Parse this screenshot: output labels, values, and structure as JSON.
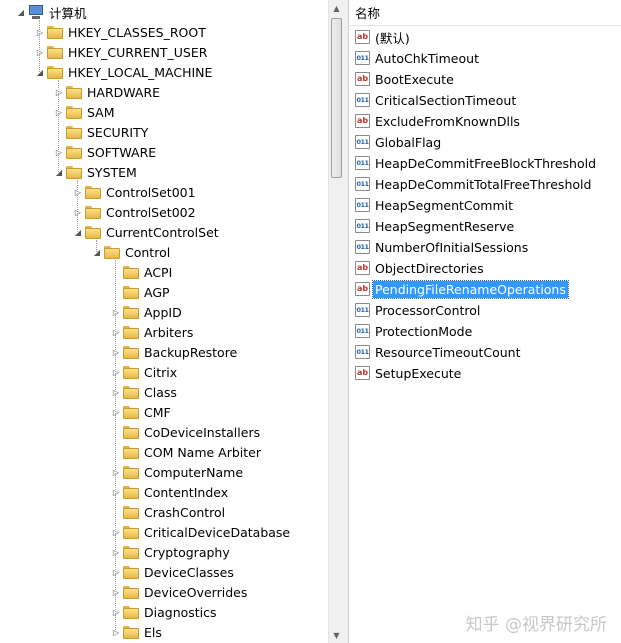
{
  "tree": {
    "items": [
      {
        "label": "计算机",
        "depth": 0,
        "expander": "expanded",
        "icon": "computer-icon"
      },
      {
        "label": "HKEY_CLASSES_ROOT",
        "depth": 1,
        "expander": "collapsed",
        "icon": "folder-icon"
      },
      {
        "label": "HKEY_CURRENT_USER",
        "depth": 1,
        "expander": "collapsed",
        "icon": "folder-icon"
      },
      {
        "label": "HKEY_LOCAL_MACHINE",
        "depth": 1,
        "expander": "expanded",
        "icon": "folder-icon"
      },
      {
        "label": "HARDWARE",
        "depth": 2,
        "expander": "collapsed",
        "icon": "folder-icon"
      },
      {
        "label": "SAM",
        "depth": 2,
        "expander": "collapsed",
        "icon": "folder-icon"
      },
      {
        "label": "SECURITY",
        "depth": 2,
        "expander": "none",
        "icon": "folder-icon"
      },
      {
        "label": "SOFTWARE",
        "depth": 2,
        "expander": "collapsed",
        "icon": "folder-icon"
      },
      {
        "label": "SYSTEM",
        "depth": 2,
        "expander": "expanded",
        "icon": "folder-icon"
      },
      {
        "label": "ControlSet001",
        "depth": 3,
        "expander": "collapsed",
        "icon": "folder-icon"
      },
      {
        "label": "ControlSet002",
        "depth": 3,
        "expander": "collapsed",
        "icon": "folder-icon"
      },
      {
        "label": "CurrentControlSet",
        "depth": 3,
        "expander": "expanded",
        "icon": "folder-icon"
      },
      {
        "label": "Control",
        "depth": 4,
        "expander": "expanded",
        "icon": "folder-icon"
      },
      {
        "label": "ACPI",
        "depth": 5,
        "expander": "none",
        "icon": "folder-icon"
      },
      {
        "label": "AGP",
        "depth": 5,
        "expander": "none",
        "icon": "folder-icon"
      },
      {
        "label": "AppID",
        "depth": 5,
        "expander": "collapsed",
        "icon": "folder-icon"
      },
      {
        "label": "Arbiters",
        "depth": 5,
        "expander": "collapsed",
        "icon": "folder-icon"
      },
      {
        "label": "BackupRestore",
        "depth": 5,
        "expander": "collapsed",
        "icon": "folder-icon"
      },
      {
        "label": "Citrix",
        "depth": 5,
        "expander": "collapsed",
        "icon": "folder-icon"
      },
      {
        "label": "Class",
        "depth": 5,
        "expander": "collapsed",
        "icon": "folder-icon"
      },
      {
        "label": "CMF",
        "depth": 5,
        "expander": "collapsed",
        "icon": "folder-icon"
      },
      {
        "label": "CoDeviceInstallers",
        "depth": 5,
        "expander": "none",
        "icon": "folder-icon"
      },
      {
        "label": "COM Name Arbiter",
        "depth": 5,
        "expander": "none",
        "icon": "folder-icon"
      },
      {
        "label": "ComputerName",
        "depth": 5,
        "expander": "collapsed",
        "icon": "folder-icon"
      },
      {
        "label": "ContentIndex",
        "depth": 5,
        "expander": "collapsed",
        "icon": "folder-icon"
      },
      {
        "label": "CrashControl",
        "depth": 5,
        "expander": "none",
        "icon": "folder-icon"
      },
      {
        "label": "CriticalDeviceDatabase",
        "depth": 5,
        "expander": "collapsed",
        "icon": "folder-icon"
      },
      {
        "label": "Cryptography",
        "depth": 5,
        "expander": "collapsed",
        "icon": "folder-icon"
      },
      {
        "label": "DeviceClasses",
        "depth": 5,
        "expander": "collapsed",
        "icon": "folder-icon"
      },
      {
        "label": "DeviceOverrides",
        "depth": 5,
        "expander": "collapsed",
        "icon": "folder-icon"
      },
      {
        "label": "Diagnostics",
        "depth": 5,
        "expander": "collapsed",
        "icon": "folder-icon"
      },
      {
        "label": "Els",
        "depth": 5,
        "expander": "collapsed",
        "icon": "folder-icon"
      }
    ]
  },
  "values_list": {
    "column_header": "名称",
    "items": [
      {
        "name": "(默认)",
        "type": "string",
        "icon": "string-value-icon",
        "selected": false
      },
      {
        "name": "AutoChkTimeout",
        "type": "binary",
        "icon": "binary-value-icon",
        "selected": false
      },
      {
        "name": "BootExecute",
        "type": "string",
        "icon": "string-value-icon",
        "selected": false
      },
      {
        "name": "CriticalSectionTimeout",
        "type": "binary",
        "icon": "binary-value-icon",
        "selected": false
      },
      {
        "name": "ExcludeFromKnownDlls",
        "type": "string",
        "icon": "string-value-icon",
        "selected": false
      },
      {
        "name": "GlobalFlag",
        "type": "binary",
        "icon": "binary-value-icon",
        "selected": false
      },
      {
        "name": "HeapDeCommitFreeBlockThreshold",
        "type": "binary",
        "icon": "binary-value-icon",
        "selected": false
      },
      {
        "name": "HeapDeCommitTotalFreeThreshold",
        "type": "binary",
        "icon": "binary-value-icon",
        "selected": false
      },
      {
        "name": "HeapSegmentCommit",
        "type": "binary",
        "icon": "binary-value-icon",
        "selected": false
      },
      {
        "name": "HeapSegmentReserve",
        "type": "binary",
        "icon": "binary-value-icon",
        "selected": false
      },
      {
        "name": "NumberOfInitialSessions",
        "type": "binary",
        "icon": "binary-value-icon",
        "selected": false
      },
      {
        "name": "ObjectDirectories",
        "type": "string",
        "icon": "string-value-icon",
        "selected": false
      },
      {
        "name": "PendingFileRenameOperations",
        "type": "string",
        "icon": "string-value-icon",
        "selected": true
      },
      {
        "name": "ProcessorControl",
        "type": "binary",
        "icon": "binary-value-icon",
        "selected": false
      },
      {
        "name": "ProtectionMode",
        "type": "binary",
        "icon": "binary-value-icon",
        "selected": false
      },
      {
        "name": "ResourceTimeoutCount",
        "type": "binary",
        "icon": "binary-value-icon",
        "selected": false
      },
      {
        "name": "SetupExecute",
        "type": "string",
        "icon": "string-value-icon",
        "selected": false
      }
    ]
  },
  "icon_glyphs": {
    "string": "ab",
    "binary": "011"
  },
  "watermark": "知乎 @视界研究所",
  "colors": {
    "selection": "#3399ff",
    "folder": "#e7b846",
    "string_icon": "#c0392b",
    "binary_icon": "#1f5fb0"
  }
}
